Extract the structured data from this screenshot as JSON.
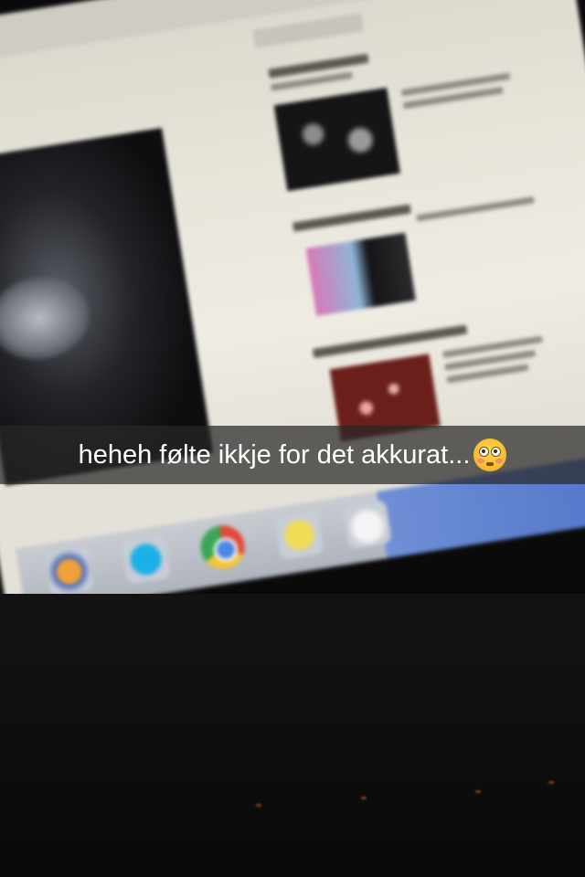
{
  "snap": {
    "caption": "heheh følte ikkje for det akkurat...",
    "emoji_icon": "flushed-face-icon"
  },
  "photo": {
    "subject": "photo-of-computer-monitor",
    "dock_icons": [
      "firefox-icon",
      "skype-icon",
      "chrome-icon",
      "notes-icon",
      "cloud-icon"
    ]
  },
  "colors": {
    "caption_bg": "#282828",
    "caption_text": "#ffffff",
    "emoji": "#f4b52a"
  }
}
